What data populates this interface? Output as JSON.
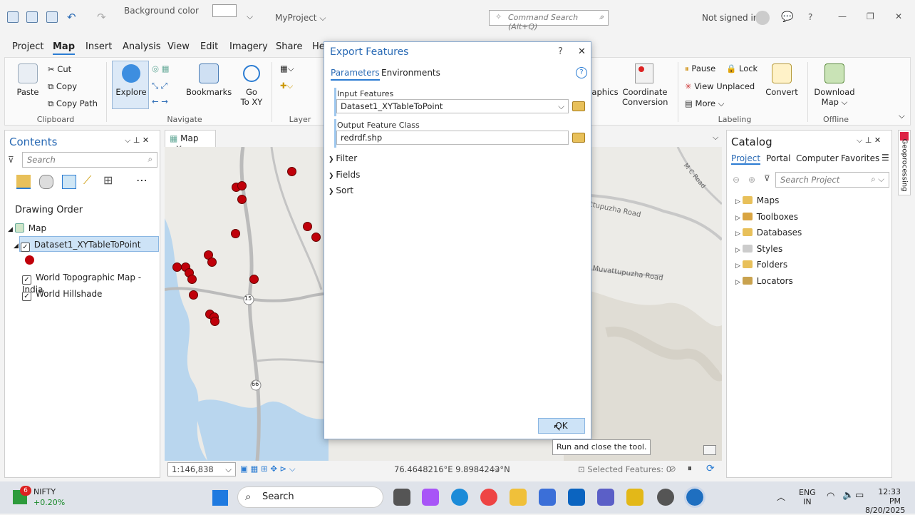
{
  "qat": {
    "background_color_label": "Background color",
    "project_name": "MyProject ⌵",
    "command_search_placeholder": "Command Search (Alt+Q)",
    "sign_in": "Not signed in",
    "help": "?"
  },
  "menu": [
    "Project",
    "Map",
    "Insert",
    "Analysis",
    "View",
    "Edit",
    "Imagery",
    "Share",
    "He"
  ],
  "ribbon": {
    "paste": "Paste",
    "cut": "Cut",
    "copy": "Copy",
    "copy_path": "Copy Path",
    "clipboard": "Clipboard",
    "explore": "Explore",
    "bookmarks": "Bookmarks",
    "go_to": "Go",
    "go_to2": "To XY",
    "navigate": "Navigate",
    "layer": "Layer",
    "graphics": "aphics",
    "coord_conv": "Coordinate",
    "coord_conv2": "Conversion",
    "pause": "Pause",
    "lock": "Lock",
    "view_unplaced": "View Unplaced",
    "more": "More ⌵",
    "convert": "Convert",
    "labeling": "Labeling",
    "download_map": "Download",
    "download_map2": "Map ⌵",
    "offline": "Offline"
  },
  "contents": {
    "title": "Contents",
    "search_placeholder": "Search",
    "drawing_order": "Drawing Order",
    "items": [
      "Map",
      "Dataset1_XYTableToPoint",
      "World Topographic Map - India",
      "World Hillshade"
    ]
  },
  "map_tab": {
    "label": "Map",
    "close": "✕"
  },
  "map_labels": {
    "route15": "15",
    "route66": "66",
    "road1": "attupuzha Road",
    "road2": "Muvattupuzha Road",
    "road3": "M C Road"
  },
  "dialog": {
    "title": "Export Features",
    "help": "?",
    "close": "✕",
    "tabs": [
      "Parameters",
      "Environments"
    ],
    "input_label": "Input Features",
    "input_value": "Dataset1_XYTableToPoint",
    "output_label": "Output Feature Class",
    "output_value": "redrdf.shp",
    "sections": [
      "Filter",
      "Fields",
      "Sort"
    ],
    "ok": "OK",
    "tooltip": "Run and close the tool."
  },
  "catalog": {
    "title": "Catalog",
    "tabs": [
      "Project",
      "Portal",
      "Computer",
      "Favorites"
    ],
    "search_placeholder": "Search Project",
    "items": [
      "Maps",
      "Toolboxes",
      "Databases",
      "Styles",
      "Folders",
      "Locators"
    ],
    "side_tab": "Geoprocessing"
  },
  "status": {
    "scale": "1:146,838",
    "coords": "76.4648216°E 9.8984243°N",
    "selected": "Selected Features: 0"
  },
  "taskbar": {
    "ticker": "NIFTY",
    "ticker_change": "+0.20%",
    "ticker_badge": "6",
    "search": "Search",
    "lang1": "ENG",
    "lang2": "IN",
    "time": "12:33 PM",
    "date": "8/20/2025"
  }
}
